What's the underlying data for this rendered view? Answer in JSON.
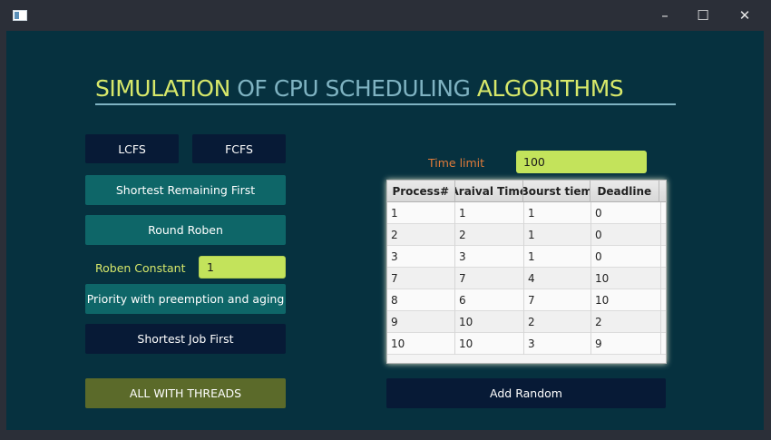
{
  "window": {
    "minimize_glyph": "–",
    "maximize_glyph": "☐",
    "close_glyph": "✕"
  },
  "title": {
    "word1": "SIMULATION",
    "word2": " OF CPU SCHEDULING ",
    "word3": "ALGORITHMS"
  },
  "buttons": {
    "lcfs": "LCFS",
    "fcfs": "FCFS",
    "srf": "Shortest Remaining First",
    "rr": "Round Roben",
    "priority": "Priority with preemption and aging",
    "sjf": "Shortest Job First",
    "all_threads": "ALL WITH THREADS",
    "add_random": "Add Random"
  },
  "roben_constant": {
    "label": "Roben Constant",
    "value": "1"
  },
  "time_limit": {
    "label": "Time limit",
    "value": "100"
  },
  "table": {
    "headers": [
      "Process#",
      "Araival Time",
      "Bourst tiem",
      "Deadline"
    ],
    "rows": [
      [
        "1",
        "1",
        "1",
        "0"
      ],
      [
        "2",
        "2",
        "1",
        "0"
      ],
      [
        "3",
        "3",
        "1",
        "0"
      ],
      [
        "7",
        "7",
        "4",
        "10"
      ],
      [
        "8",
        "6",
        "7",
        "10"
      ],
      [
        "9",
        "10",
        "2",
        "2"
      ],
      [
        "10",
        "10",
        "3",
        "9"
      ]
    ]
  },
  "colors": {
    "background": "#06313f",
    "title_yellow": "#d7e86a",
    "title_teal": "#7fb3c2",
    "input_green": "#c3e35b",
    "button_dark": "#071a36",
    "button_teal": "#0e6668",
    "button_olive": "#5b6a2a",
    "label_orange": "#e07b3a",
    "label_yellow": "#d7e86a"
  }
}
